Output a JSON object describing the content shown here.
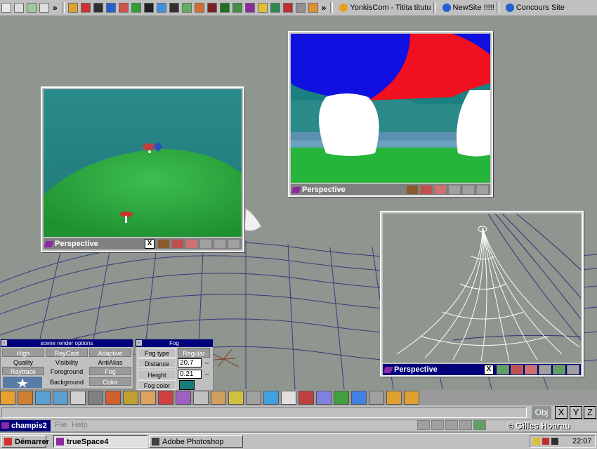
{
  "quicklaunch": {
    "chevrons": [
      "»",
      "»",
      "»"
    ],
    "links": [
      {
        "label": "YonkisCom - Titita titutu",
        "icon": "yonkis-icon"
      },
      {
        "label": "NewSite !!!!!",
        "icon": "ie-icon"
      },
      {
        "label": "Concours Site",
        "icon": "ie-icon"
      }
    ]
  },
  "viewports": [
    {
      "title": "Perspective",
      "close": "X"
    },
    {
      "title": "Perspective"
    },
    {
      "title": "Perspective",
      "close": "X"
    }
  ],
  "render_options": {
    "title": "scene render options",
    "buttons": [
      {
        "label": "High",
        "selected": true
      },
      {
        "label": "RayCast",
        "selected": true
      },
      {
        "label": "Adaptive",
        "selected": true
      },
      {
        "label": "Quality",
        "selected": false
      },
      {
        "label": "Visibility",
        "selected": false
      },
      {
        "label": "AntiAlias",
        "selected": false
      },
      {
        "label": "Raytrace",
        "selected": true
      },
      {
        "label": "Foreground",
        "selected": false
      },
      {
        "label": "Fog",
        "selected": true
      },
      {
        "label": "Background",
        "selected": false
      },
      {
        "label": "Color",
        "selected": true
      }
    ]
  },
  "fog": {
    "title": "Fog",
    "type_label": "Fog type",
    "type_value": "Regular",
    "distance_label": "Distance",
    "distance_value": "20.7",
    "height_label": "Height",
    "height_value": "0.21",
    "color_label": "Fog color",
    "color_swatch": "#1a7a7a"
  },
  "axis_buttons": [
    "Obj",
    "X",
    "Y",
    "Z"
  ],
  "app": {
    "doc_title": "champis2",
    "menus": [
      "File",
      "Help"
    ],
    "copyright": "© Gilles Hoarau"
  },
  "taskbar": {
    "start": "Démarrer",
    "tasks": [
      "trueSpace4",
      "Adobe Photoshop"
    ],
    "clock": "22:07"
  },
  "colors": {
    "scene_bg": "#8f958f",
    "title_bar": "#00007b",
    "panel": "#c0c0c0",
    "grass": "#2aa83a",
    "sky_teal": "#2a8a8a"
  }
}
